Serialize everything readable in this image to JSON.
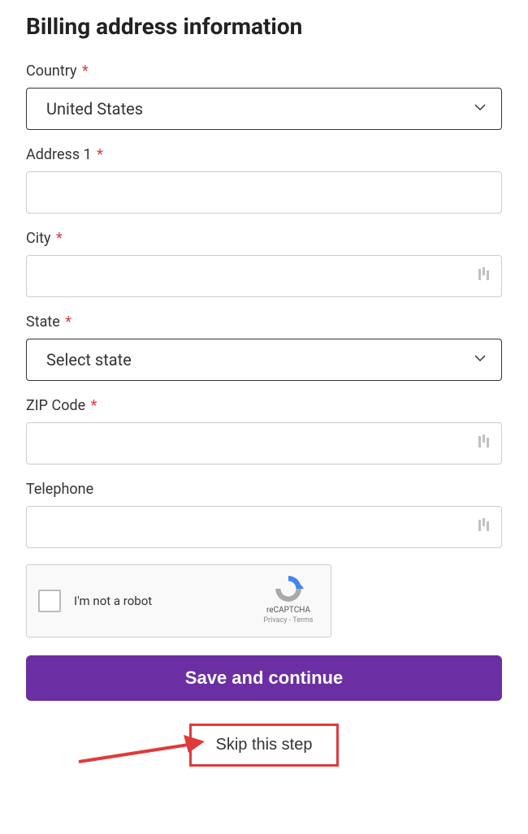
{
  "title": "Billing address information",
  "required_mark": "*",
  "fields": {
    "country": {
      "label": "Country",
      "value": "United States",
      "required": true
    },
    "address1": {
      "label": "Address 1",
      "value": "",
      "required": true
    },
    "city": {
      "label": "City",
      "value": "",
      "required": true
    },
    "state": {
      "label": "State",
      "value": "Select state",
      "required": true
    },
    "zip": {
      "label": "ZIP Code",
      "value": "",
      "required": true
    },
    "telephone": {
      "label": "Telephone",
      "value": "",
      "required": false
    }
  },
  "recaptcha": {
    "label": "I'm not a robot",
    "brand": "reCAPTCHA",
    "privacy": "Privacy",
    "terms": "Terms",
    "separator": " - "
  },
  "buttons": {
    "primary": "Save and continue",
    "skip": "Skip this step"
  }
}
